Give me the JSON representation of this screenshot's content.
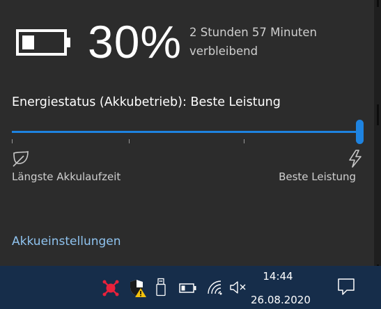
{
  "battery": {
    "percent_text": "30%",
    "level": 0.3,
    "remaining_line1": "2 Stunden 57 Minuten",
    "remaining_line2": "verbleibend"
  },
  "power_mode": {
    "label": "Energiestatus (Akkubetrieb): Beste Leistung",
    "slider_value": 1.0,
    "min_label": "Längste Akkulaufzeit",
    "max_label": "Beste Leistung"
  },
  "settings_link": "Akkueinstellungen",
  "colors": {
    "accent": "#1e83e0",
    "link": "#8fc3ef",
    "flyout_bg": "#2c2c2c",
    "taskbar_bg": "#162d4a"
  },
  "taskbar": {
    "tray_icons": [
      "network-alert-icon",
      "security-warning-icon",
      "usb-drive-icon",
      "battery-icon",
      "wifi-icon",
      "volume-muted-icon"
    ],
    "time": "14:44",
    "date": "26.08.2020",
    "notification_icon": "action-center-icon"
  }
}
